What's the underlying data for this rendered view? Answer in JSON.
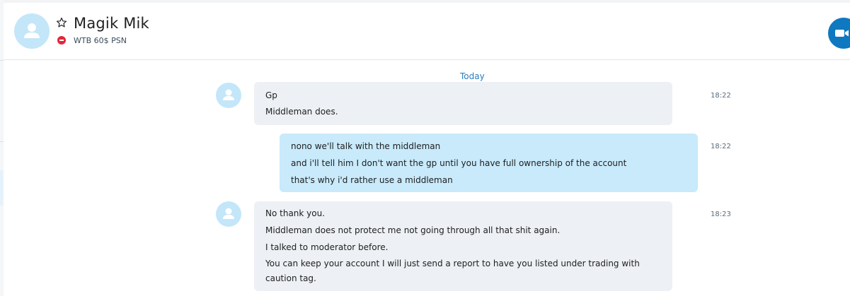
{
  "header": {
    "contact_name": "Magik Mik",
    "mood_message": "WTB 60$ PSN",
    "status": "do-not-disturb",
    "icons": {
      "favorite": "star-outline-icon",
      "status": "do-not-disturb-icon",
      "video": "video-call-icon"
    }
  },
  "conversation": {
    "date_separator": "Today",
    "messages": [
      {
        "direction": "incoming",
        "time": "18:22",
        "lines": [
          "Gp",
          "Middleman does."
        ]
      },
      {
        "direction": "outgoing",
        "time": "18:22",
        "lines": [
          "nono we'll talk with the middleman",
          "and i'll tell him I don't want the gp until you have full ownership of the account",
          "that's why i'd rather use a middleman"
        ]
      },
      {
        "direction": "incoming",
        "time": "18:23",
        "lines": [
          "No thank you.",
          "Middleman does not protect me not going through all that shit again.",
          "I talked to moderator before.",
          "You can keep your account I will just send a report to have you listed under trading with caution tag."
        ]
      }
    ]
  },
  "colors": {
    "incoming_bubble": "#edf0f4",
    "outgoing_bubble": "#c8eafb",
    "accent": "#0e78c0",
    "status_dnd": "#e0283a",
    "avatar_bg": "#c3e6f9"
  }
}
